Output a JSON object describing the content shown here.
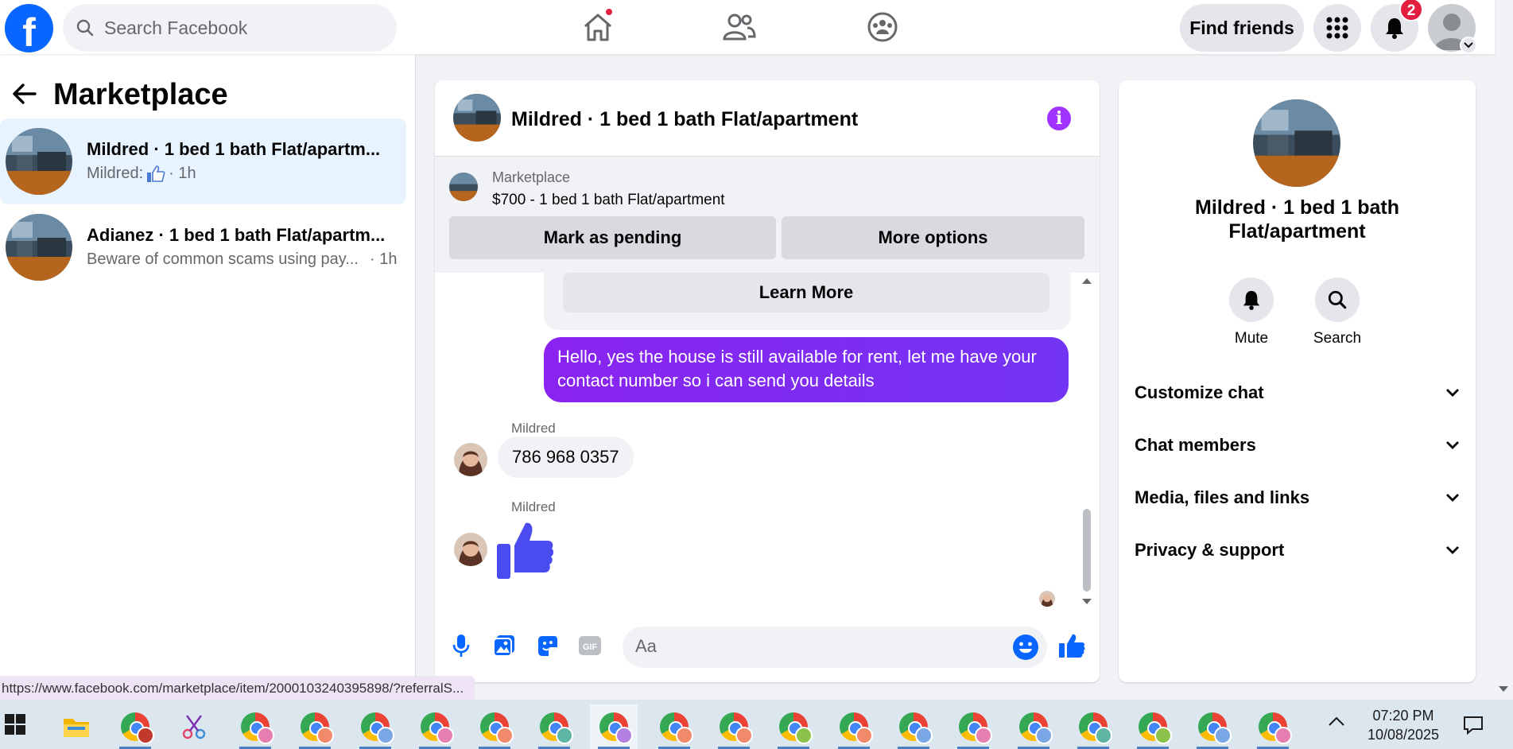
{
  "topbar": {
    "logo_letter": "f",
    "search_placeholder": "Search Facebook",
    "find_friends_label": "Find friends",
    "notification_count": "2",
    "nav_icons": [
      "home-icon",
      "friends-icon",
      "groups-icon"
    ],
    "accent_color": "#0866ff"
  },
  "sidebar": {
    "title": "Marketplace",
    "threads": [
      {
        "title": "Mildred · 1 bed 1 bath Flat/apartm...",
        "preview_prefix": "Mildred:",
        "time": "· 1h",
        "active": true
      },
      {
        "title": "Adianez · 1 bed 1 bath Flat/apartm...",
        "preview_prefix": "Beware of common scams using pay...",
        "time": "· 1h",
        "active": false
      }
    ]
  },
  "chat": {
    "header_title": "Mildred · 1 bed 1 bath Flat/apartment",
    "info_glyph": "i",
    "listing_label": "Marketplace",
    "listing_price": "$700 - 1 bed 1 bath Flat/apartment",
    "mark_pending_label": "Mark as pending",
    "more_options_label": "More options",
    "learn_more_label": "Learn More",
    "outgoing_message": "Hello, yes the house is still available for rent, let me have your contact number so i can send you details",
    "sender_name_1": "Mildred",
    "incoming_message": "786 968 0357",
    "sender_name_2": "Mildred",
    "composer_placeholder": "Aa",
    "outgoing_color": "#7b2ff7"
  },
  "info_panel": {
    "title": "Mildred · 1 bed 1 bath Flat/apartment",
    "mute_label": "Mute",
    "search_label": "Search",
    "sections": [
      "Customize chat",
      "Chat members",
      "Media, files and links",
      "Privacy & support"
    ]
  },
  "status_url": "https://www.facebook.com/marketplace/item/2000103240395898/?referralS...",
  "taskbar": {
    "time": "07:20 PM",
    "date": "10/08/2025"
  }
}
